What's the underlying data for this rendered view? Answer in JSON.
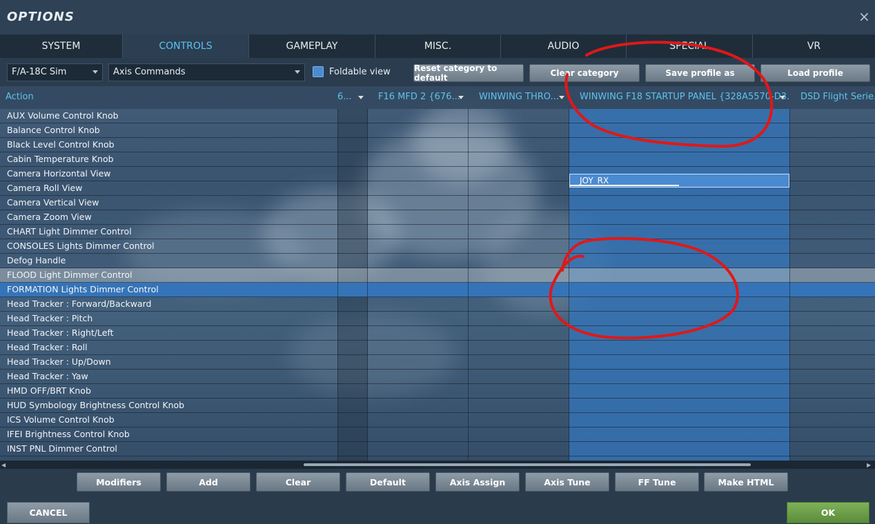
{
  "window": {
    "title": "OPTIONS",
    "close_glyph": "×"
  },
  "tabs": [
    {
      "label": "SYSTEM",
      "active": false
    },
    {
      "label": "CONTROLS",
      "active": true
    },
    {
      "label": "GAMEPLAY",
      "active": false
    },
    {
      "label": "MISC.",
      "active": false
    },
    {
      "label": "AUDIO",
      "active": false
    },
    {
      "label": "SPECIAL",
      "active": false
    },
    {
      "label": "VR",
      "active": false
    }
  ],
  "toolbar": {
    "aircraft_select": "F/A-18C Sim",
    "category_select": "Axis Commands",
    "foldable_view_label": "Foldable view",
    "foldable_view_checked": true,
    "buttons": [
      "Reset category to default",
      "Clear category",
      "Save profile as",
      "Load profile"
    ]
  },
  "table": {
    "action_header": "Action",
    "column_headers": [
      "6...",
      "F16 MFD 2 {676...",
      "WINWING THRO...",
      "WINWING F18 STARTUP PANEL {328A5570-D3...",
      "DSD Flight Serie..."
    ],
    "rows": [
      "AUX Volume Control Knob",
      "Balance Control Knob",
      "Black Level Control Knob",
      "Cabin Temperature Knob",
      "Camera Horizontal View",
      "Camera Roll View",
      "Camera Vertical View",
      "Camera Zoom View",
      "CHART Light Dimmer Control",
      "CONSOLES Lights Dimmer Control",
      "Defog Handle",
      "FLOOD Light Dimmer Control",
      "FORMATION Lights Dimmer Control",
      "Head Tracker : Forward/Backward",
      "Head Tracker : Pitch",
      "Head Tracker : Right/Left",
      "Head Tracker : Roll",
      "Head Tracker : Up/Down",
      "Head Tracker : Yaw",
      "HMD OFF/BRT Knob",
      "HUD Symbology Brightness Control Knob",
      "ICS Volume Control Knob",
      "IFEI Brightness Control Knob",
      "INST PNL Dimmer Control"
    ],
    "selected_row": "FORMATION Lights Dimmer Control",
    "selected_cell_value": "JOY_RX"
  },
  "bottom_buttons": [
    "Modifiers",
    "Add",
    "Clear",
    "Default",
    "Axis Assign",
    "Axis Tune",
    "FF Tune",
    "Make HTML"
  ],
  "footer": {
    "cancel": "CANCEL",
    "ok": "OK"
  },
  "colors": {
    "accent_text": "#5cc3ee",
    "selected_row": "#3574b8",
    "ok_green": "#6a9e48",
    "annotation_red": "#e01818"
  }
}
